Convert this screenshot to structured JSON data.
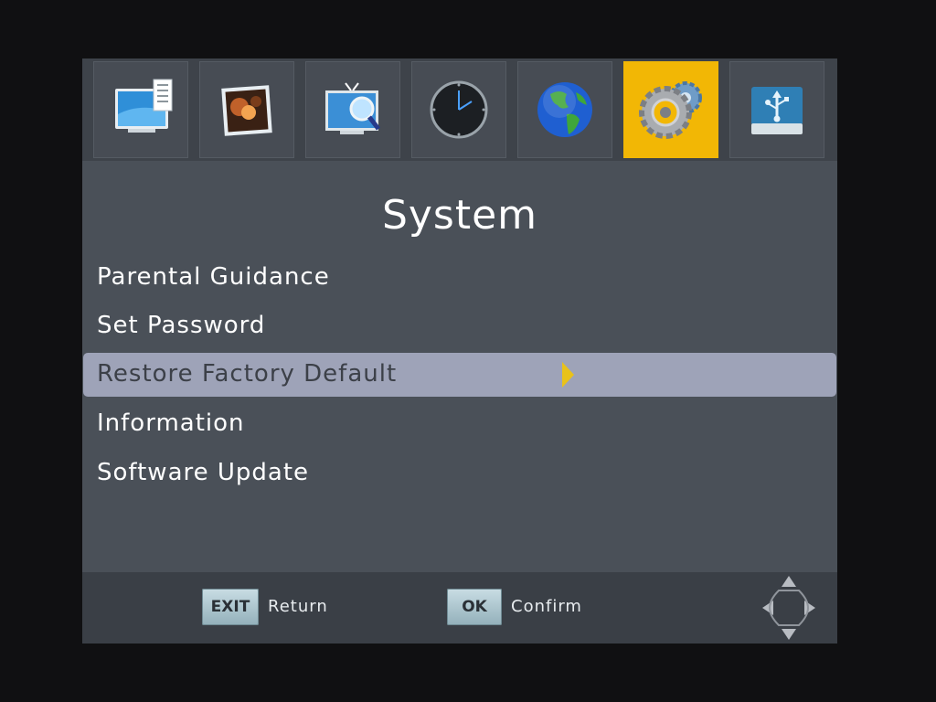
{
  "menu": {
    "title": "System",
    "items": [
      {
        "label": "Parental Guidance"
      },
      {
        "label": "Set Password"
      },
      {
        "label": "Restore Factory Default"
      },
      {
        "label": "Information"
      },
      {
        "label": "Software Update"
      }
    ],
    "selected_index": 2
  },
  "iconbar": {
    "icons": [
      "screen-settings-icon",
      "picture-icon",
      "tv-search-icon",
      "clock-icon",
      "globe-icon",
      "gears-icon",
      "usb-drive-icon"
    ],
    "active_icon": "gears-icon",
    "active_color": "#f2b705"
  },
  "footer": {
    "exit_key": "EXIT",
    "exit_label": "Return",
    "ok_key": "OK",
    "ok_label": "Confirm",
    "dpad_icon": "dpad-icon"
  },
  "colors": {
    "panel": "#4a5058",
    "selection": "#9ea3b8",
    "arrow": "#e9c21a"
  }
}
